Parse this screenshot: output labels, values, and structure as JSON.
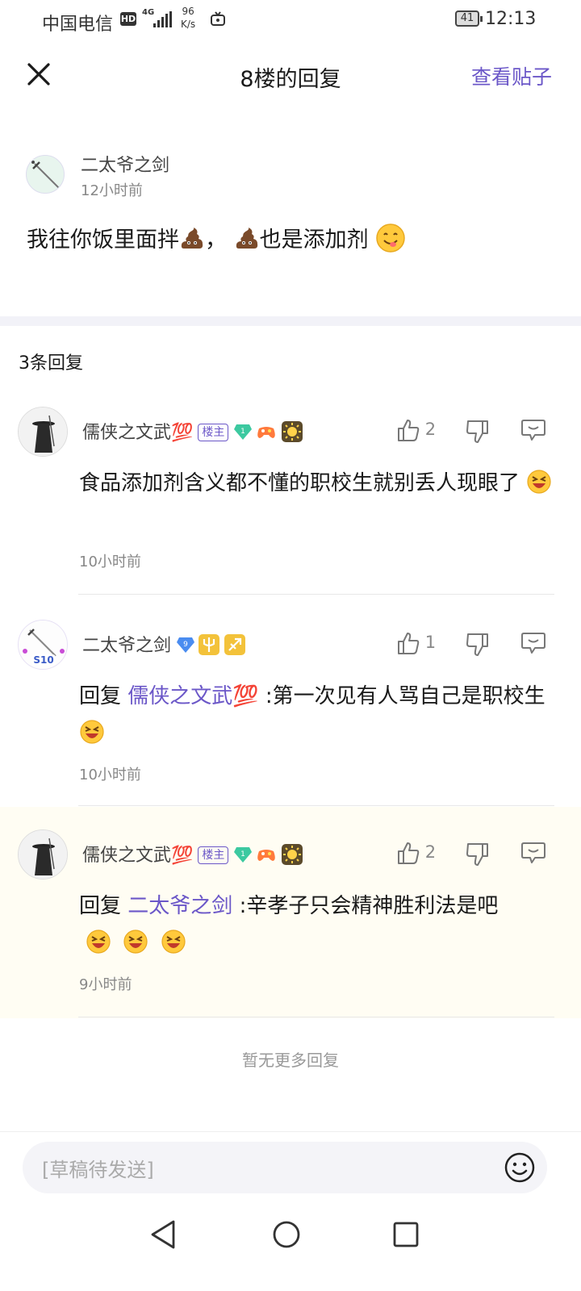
{
  "status_bar": {
    "carrier": "中国电信",
    "hd": "HD",
    "network": "4G",
    "speed_value": "96",
    "speed_unit": "K/s",
    "battery": "41",
    "time": "12:13"
  },
  "header": {
    "title": "8楼的回复",
    "view_post": "查看贴子"
  },
  "post": {
    "author": "二太爷之剑",
    "time": "12小时前",
    "text_part1": "我往你饭里面拌",
    "text_part2": "，",
    "text_part3": "也是添加剂"
  },
  "reply_count": "3条回复",
  "replies": [
    {
      "author": "儒侠之文武💯",
      "badge": "楼主",
      "level": "1",
      "likes": "2",
      "text": "食品添加剂含义都不懂的职校生就别丢人现眼了",
      "time": "10小时前"
    },
    {
      "author": "二太爷之剑",
      "level": "9",
      "avatar_tag": "S10",
      "likes": "1",
      "reply_prefix": "回复",
      "mention": "儒侠之文武💯",
      "text": ":第一次见有人骂自己是职校生",
      "time": "10小时前"
    },
    {
      "author": "儒侠之文武💯",
      "badge": "楼主",
      "level": "1",
      "likes": "2",
      "reply_prefix": "回复",
      "mention": "二太爷之剑",
      "text": ":辛孝子只会精神胜利法是吧",
      "time": "9小时前"
    }
  ],
  "no_more": "暂无更多回复",
  "input": {
    "placeholder": "[草稿待发送]"
  },
  "colors": {
    "accent": "#6b57c8",
    "highlight_bg": "#fffdf3",
    "divider": "#f2f2f8"
  }
}
